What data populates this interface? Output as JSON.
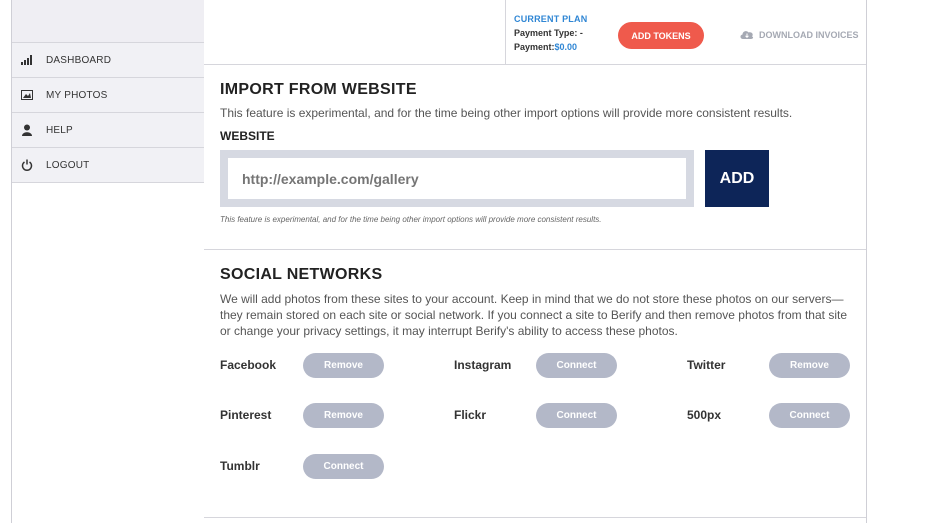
{
  "sidebar": {
    "items": [
      {
        "label": "DASHBOARD",
        "icon": "bar-chart-icon"
      },
      {
        "label": "MY PHOTOS",
        "icon": "photo-icon"
      },
      {
        "label": "HELP",
        "icon": "person-icon"
      },
      {
        "label": "LOGOUT",
        "icon": "power-icon"
      }
    ]
  },
  "plan": {
    "title": "CURRENT PLAN",
    "payment_type_label": "Payment Type:",
    "payment_type_value": "-",
    "payment_label": "Payment:",
    "payment_value": "$0.00",
    "add_tokens_label": "ADD TOKENS",
    "download_label": "DOWNLOAD INVOICES"
  },
  "import": {
    "title": "IMPORT FROM WEBSITE",
    "description": "This feature is experimental, and for the time being other import options will provide more consistent results.",
    "field_label": "WEBSITE",
    "input_placeholder": "http://example.com/gallery",
    "add_label": "ADD",
    "note": "This feature is experimental, and for the time being other import options will provide more consistent results."
  },
  "social": {
    "title": "SOCIAL NETWORKS",
    "description": "We will add photos from these sites to your account. Keep in mind that we do not store these photos on our servers—they remain stored on each site or social network. If you connect a site to Berify and then remove photos from that site or change your privacy settings, it may interrupt Berify's ability to access these photos.",
    "networks": [
      {
        "name": "Facebook",
        "action": "Remove"
      },
      {
        "name": "Instagram",
        "action": "Connect"
      },
      {
        "name": "Twitter",
        "action": "Remove"
      },
      {
        "name": "Pinterest",
        "action": "Remove"
      },
      {
        "name": "Flickr",
        "action": "Connect"
      },
      {
        "name": "500px",
        "action": "Connect"
      },
      {
        "name": "Tumblr",
        "action": "Connect"
      }
    ]
  },
  "colors": {
    "accent_blue": "#2f86d4",
    "add_tokens": "#ef5a4c",
    "navy": "#0d2558",
    "pill_gray": "#b3b8c8"
  }
}
